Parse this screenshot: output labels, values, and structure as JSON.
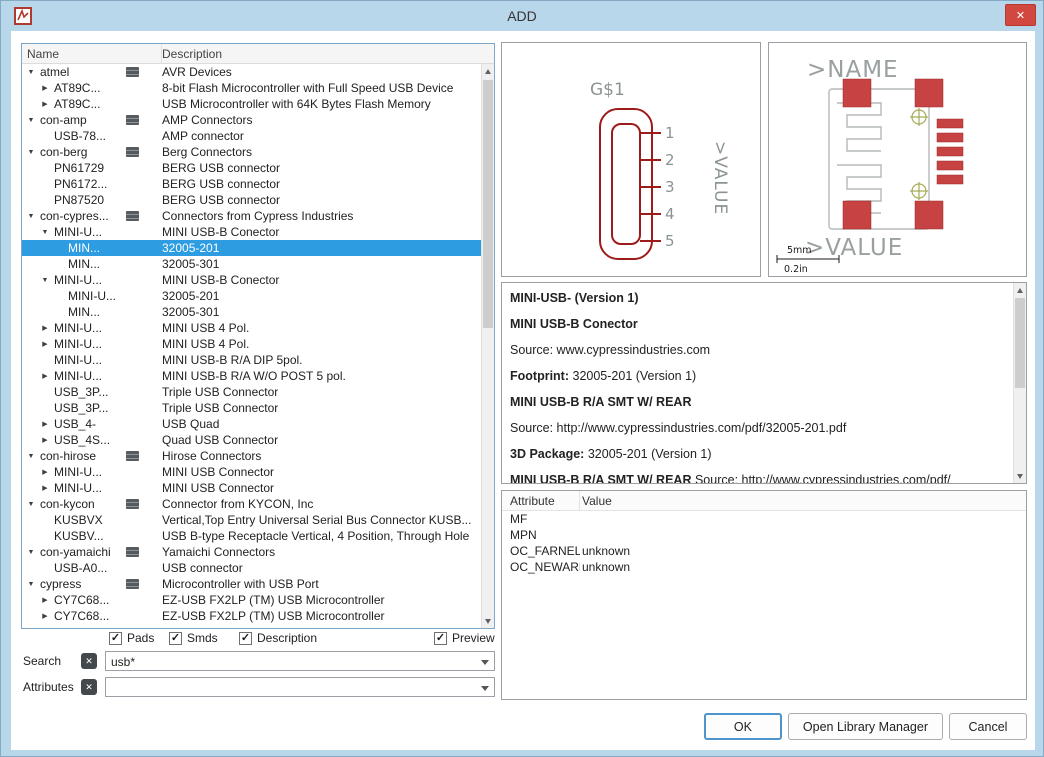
{
  "window": {
    "title": "ADD"
  },
  "icons": {
    "close": "✕",
    "clear": "✕",
    "check": "✓",
    "collapse": "▼",
    "expand": "▶"
  },
  "colors": {
    "frame": "#b9d7eb",
    "selection": "#2d9ce0",
    "close_button": "#d14840",
    "symbol_stroke": "#9c1c1c",
    "pad_fill": "#c74242",
    "hole_stroke": "#a7ac56",
    "preview_text": "#98a0a0"
  },
  "tree": {
    "columns": {
      "name": "Name",
      "description": "Description"
    },
    "items": [
      {
        "lvl": 0,
        "exp": "open",
        "lib": true,
        "name": "atmel",
        "desc": "AVR Devices"
      },
      {
        "lvl": 1,
        "exp": "closed",
        "name": "AT89C...",
        "desc": "8-bit Flash Microcontroller with Full Speed USB Device"
      },
      {
        "lvl": 1,
        "exp": "closed",
        "name": "AT89C...",
        "desc": "USB Microcontroller with 64K Bytes Flash Memory"
      },
      {
        "lvl": 0,
        "exp": "open",
        "lib": true,
        "name": "con-amp",
        "desc": "AMP Connectors"
      },
      {
        "lvl": 1,
        "exp": "none",
        "name": "USB-78...",
        "desc": "AMP connector"
      },
      {
        "lvl": 0,
        "exp": "open",
        "lib": true,
        "name": "con-berg",
        "desc": "Berg Connectors"
      },
      {
        "lvl": 1,
        "exp": "none",
        "name": "PN61729",
        "desc": "BERG USB connector"
      },
      {
        "lvl": 1,
        "exp": "none",
        "name": "PN6172...",
        "desc": "BERG USB connector"
      },
      {
        "lvl": 1,
        "exp": "none",
        "name": "PN87520",
        "desc": "BERG USB connector"
      },
      {
        "lvl": 0,
        "exp": "open",
        "lib": true,
        "name": "con-cypres...",
        "desc": "Connectors from Cypress Industries"
      },
      {
        "lvl": 1,
        "exp": "open",
        "name": "MINI-U...",
        "desc": "MINI USB-B Conector"
      },
      {
        "lvl": 2,
        "exp": "none",
        "name": "MIN...",
        "desc": "32005-201",
        "selected": true
      },
      {
        "lvl": 2,
        "exp": "none",
        "name": "MIN...",
        "desc": "32005-301"
      },
      {
        "lvl": 1,
        "exp": "open",
        "name": "MINI-U...",
        "desc": "MINI USB-B Conector"
      },
      {
        "lvl": 2,
        "exp": "none",
        "name": "MINI-U...",
        "desc": "32005-201"
      },
      {
        "lvl": 2,
        "exp": "none",
        "name": "MIN...",
        "desc": "32005-301"
      },
      {
        "lvl": 1,
        "exp": "closed",
        "name": "MINI-U...",
        "desc": "MINI USB 4 Pol."
      },
      {
        "lvl": 1,
        "exp": "closed",
        "name": "MINI-U...",
        "desc": "MINI USB 4 Pol."
      },
      {
        "lvl": 1,
        "exp": "none",
        "name": "MINI-U...",
        "desc": "MINI USB-B R/A DIP 5pol."
      },
      {
        "lvl": 1,
        "exp": "closed",
        "name": "MINI-U...",
        "desc": "MINI USB-B R/A W/O POST 5 pol."
      },
      {
        "lvl": 1,
        "exp": "none",
        "name": "USB_3P...",
        "desc": "Triple USB Connector"
      },
      {
        "lvl": 1,
        "exp": "none",
        "name": "USB_3P...",
        "desc": "Triple USB Connector"
      },
      {
        "lvl": 1,
        "exp": "closed",
        "name": "USB_4-",
        "desc": "USB Quad"
      },
      {
        "lvl": 1,
        "exp": "closed",
        "name": "USB_4S...",
        "desc": "Quad USB Connector"
      },
      {
        "lvl": 0,
        "exp": "open",
        "lib": true,
        "name": "con-hirose",
        "desc": "Hirose Connectors"
      },
      {
        "lvl": 1,
        "exp": "closed",
        "name": "MINI-U...",
        "desc": "MINI USB Connector"
      },
      {
        "lvl": 1,
        "exp": "closed",
        "name": "MINI-U...",
        "desc": "MINI USB Connector"
      },
      {
        "lvl": 0,
        "exp": "open",
        "lib": true,
        "name": "con-kycon",
        "desc": "Connector from KYCON, Inc"
      },
      {
        "lvl": 1,
        "exp": "none",
        "name": "KUSBVX",
        "desc": "Vertical,Top Entry Universal Serial Bus Connector KUSB..."
      },
      {
        "lvl": 1,
        "exp": "none",
        "name": "KUSBV...",
        "desc": "USB B-type Receptacle Vertical, 4 Position, Through Hole"
      },
      {
        "lvl": 0,
        "exp": "open",
        "lib": true,
        "name": "con-yamaichi",
        "desc": "Yamaichi Connectors"
      },
      {
        "lvl": 1,
        "exp": "none",
        "name": "USB-A0...",
        "desc": "USB connector"
      },
      {
        "lvl": 0,
        "exp": "open",
        "lib": true,
        "name": "cypress",
        "desc": "Microcontroller with USB Port"
      },
      {
        "lvl": 1,
        "exp": "closed",
        "name": "CY7C68...",
        "desc": "EZ-USB FX2LP (TM) USB Microcontroller"
      },
      {
        "lvl": 1,
        "exp": "closed",
        "name": "CY7C68...",
        "desc": "EZ-USB FX2LP (TM) USB Microcontroller"
      }
    ]
  },
  "filters": [
    {
      "label": "Pads",
      "checked": true
    },
    {
      "label": "Smds",
      "checked": true
    },
    {
      "label": "Description",
      "checked": true
    },
    {
      "label": "Preview",
      "checked": true
    }
  ],
  "search": {
    "label": "Search",
    "value": "usb*"
  },
  "attributes_filter": {
    "label": "Attributes",
    "value": ""
  },
  "symbol_preview": {
    "gate_label": "G$1",
    "pins": [
      "1",
      "2",
      "3",
      "4",
      "5"
    ],
    "value_label": ">VALUE"
  },
  "footprint_preview": {
    "name_label": ">NAME",
    "value_label": ">VALUE",
    "scale_mm": "5mm",
    "scale_in": "0.2in"
  },
  "description_panel": {
    "paragraphs": [
      [
        {
          "b": true,
          "t": "MINI-USB- (Version 1)"
        }
      ],
      [
        {
          "b": true,
          "t": "MINI USB-B Conector"
        }
      ],
      [
        {
          "b": false,
          "t": "Source: www.cypressindustries.com"
        }
      ],
      [
        {
          "b": true,
          "t": "Footprint:"
        },
        {
          "b": false,
          "t": " 32005-201 (Version 1)"
        }
      ],
      [
        {
          "b": true,
          "t": "MINI USB-B R/A SMT W/ REAR"
        }
      ],
      [
        {
          "b": false,
          "t": "Source: http://www.cypressindustries.com/pdf/32005-201.pdf"
        }
      ],
      [
        {
          "b": true,
          "t": "3D Package:"
        },
        {
          "b": false,
          "t": " 32005-201 (Version 1)"
        }
      ],
      [
        {
          "b": true,
          "t": "MINI USB-B R/A SMT W/ REAR"
        },
        {
          "b": false,
          "t": " Source: http://www.cypressindustries.com/pdf/"
        }
      ]
    ]
  },
  "attributes_table": {
    "columns": [
      "Attribute",
      "Value"
    ],
    "rows": [
      {
        "attribute": "MF",
        "value": ""
      },
      {
        "attribute": "MPN",
        "value": ""
      },
      {
        "attribute": "OC_FARNELL",
        "value": "unknown"
      },
      {
        "attribute": "OC_NEWARK",
        "value": "unknown"
      }
    ]
  },
  "buttons": {
    "ok": "OK",
    "library_manager": "Open Library Manager",
    "cancel": "Cancel"
  }
}
